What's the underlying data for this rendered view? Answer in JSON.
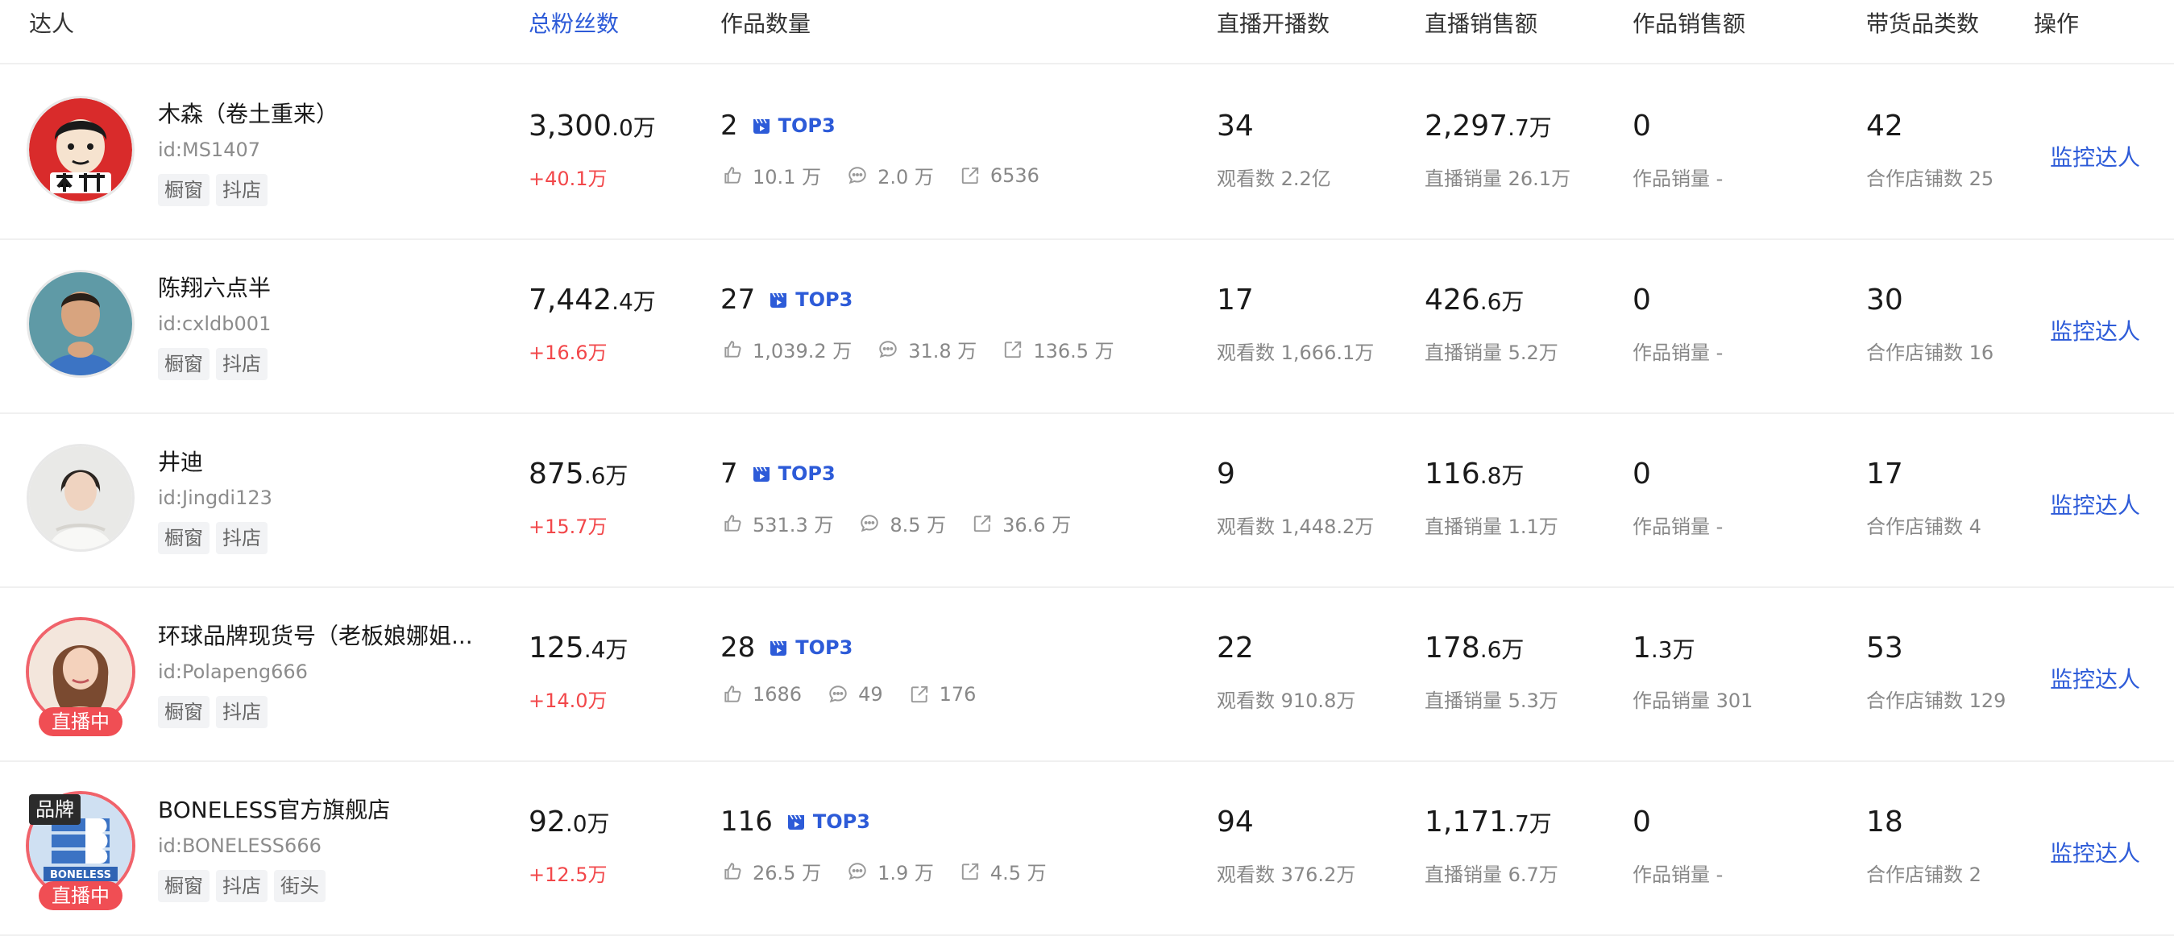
{
  "headers": {
    "talent": "达人",
    "fans": "总粉丝数",
    "works": "作品数量",
    "live_sessions": "直播开播数",
    "live_sales": "直播销售额",
    "works_sales": "作品销售额",
    "categories": "带货品类数",
    "action": "操作"
  },
  "colors": {
    "accent": "#2d5bd8",
    "increase": "#f2474a",
    "live_badge": "#f04e54"
  },
  "rows": [
    {
      "name": "木森（卷土重来）",
      "id": "id:MS1407",
      "tags": [
        "橱窗",
        "抖店",
        ""
      ],
      "avatar": "cartoon-avatar",
      "live": false,
      "brand": false,
      "live_label": "",
      "brand_label": "",
      "fans_main": "3,300",
      "fans_dec": ".0万",
      "fans_change": "+40.1万",
      "works_count": "2",
      "top3": "TOP3",
      "likes": "10.1 万",
      "comments": "2.0 万",
      "shares": "6536",
      "live_count": "34",
      "views": "观看数 2.2亿",
      "live_sales_main": "2,297",
      "live_sales_dec": ".7万",
      "live_volume": "直播销量 26.1万",
      "works_sales_main": "0",
      "works_sales_dec": "",
      "works_volume": "作品销量 -",
      "categories": "42",
      "shops": "合作店铺数 25",
      "action": "监控达人"
    },
    {
      "name": "陈翔六点半",
      "id": "id:cxldb001",
      "tags": [
        "橱窗",
        "抖店",
        ""
      ],
      "avatar": "photo-avatar-1",
      "live": false,
      "brand": false,
      "live_label": "",
      "brand_label": "",
      "fans_main": "7,442",
      "fans_dec": ".4万",
      "fans_change": "+16.6万",
      "works_count": "27",
      "top3": "TOP3",
      "likes": "1,039.2 万",
      "comments": "31.8 万",
      "shares": "136.5 万",
      "live_count": "17",
      "views": "观看数 1,666.1万",
      "live_sales_main": "426",
      "live_sales_dec": ".6万",
      "live_volume": "直播销量 5.2万",
      "works_sales_main": "0",
      "works_sales_dec": "",
      "works_volume": "作品销量 -",
      "categories": "30",
      "shops": "合作店铺数 16",
      "action": "监控达人"
    },
    {
      "name": "井迪",
      "id": "id:Jingdi123",
      "tags": [
        "橱窗",
        "抖店",
        ""
      ],
      "avatar": "photo-avatar-2",
      "live": false,
      "brand": false,
      "live_label": "",
      "brand_label": "",
      "fans_main": "875",
      "fans_dec": ".6万",
      "fans_change": "+15.7万",
      "works_count": "7",
      "top3": "TOP3",
      "likes": "531.3 万",
      "comments": "8.5 万",
      "shares": "36.6 万",
      "live_count": "9",
      "views": "观看数 1,448.2万",
      "live_sales_main": "116",
      "live_sales_dec": ".8万",
      "live_volume": "直播销量 1.1万",
      "works_sales_main": "0",
      "works_sales_dec": "",
      "works_volume": "作品销量 -",
      "categories": "17",
      "shops": "合作店铺数 4",
      "action": "监控达人"
    },
    {
      "name": "环球品牌现货号（老板娘娜姐...",
      "id": "id:Polapeng666",
      "tags": [
        "橱窗",
        "抖店",
        ""
      ],
      "avatar": "photo-avatar-3",
      "live": true,
      "brand": false,
      "live_label": "直播中",
      "brand_label": "",
      "fans_main": "125",
      "fans_dec": ".4万",
      "fans_change": "+14.0万",
      "works_count": "28",
      "top3": "TOP3",
      "likes": "1686",
      "comments": "49",
      "shares": "176",
      "live_count": "22",
      "views": "观看数 910.8万",
      "live_sales_main": "178",
      "live_sales_dec": ".6万",
      "live_volume": "直播销量 5.3万",
      "works_sales_main": "1",
      "works_sales_dec": ".3万",
      "works_volume": "作品销量 301",
      "categories": "53",
      "shops": "合作店铺数 129",
      "action": "监控达人"
    },
    {
      "name": "BONELESS官方旗舰店",
      "id": "id:BONELESS666",
      "tags": [
        "橱窗",
        "抖店",
        "街头"
      ],
      "avatar": "brand-logo-avatar",
      "live": true,
      "brand": true,
      "live_label": "直播中",
      "brand_label": "品牌",
      "fans_main": "92",
      "fans_dec": ".0万",
      "fans_change": "+12.5万",
      "works_count": "116",
      "top3": "TOP3",
      "likes": "26.5 万",
      "comments": "1.9 万",
      "shares": "4.5 万",
      "live_count": "94",
      "views": "观看数 376.2万",
      "live_sales_main": "1,171",
      "live_sales_dec": ".7万",
      "live_volume": "直播销量 6.7万",
      "works_sales_main": "0",
      "works_sales_dec": "",
      "works_volume": "作品销量 -",
      "categories": "18",
      "shops": "合作店铺数 2",
      "action": "监控达人"
    }
  ]
}
